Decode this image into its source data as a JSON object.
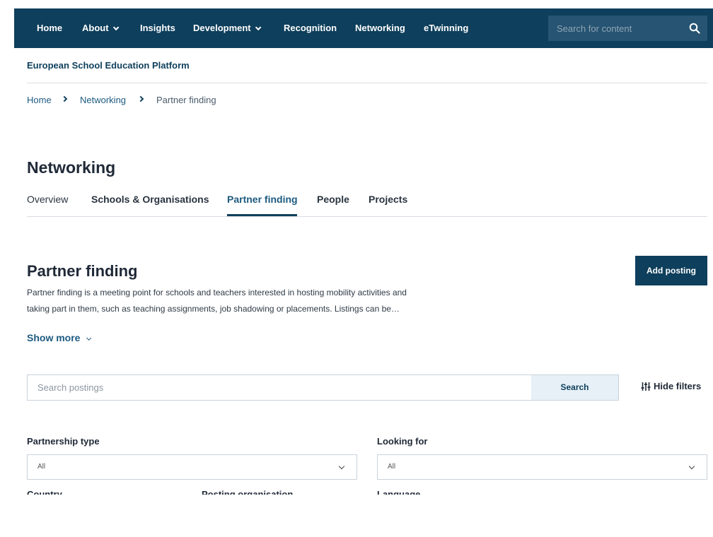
{
  "nav": {
    "items": [
      {
        "label": "Home",
        "dropdown": false
      },
      {
        "label": "About",
        "dropdown": true
      },
      {
        "label": "Insights",
        "dropdown": false
      },
      {
        "label": "Development",
        "dropdown": true
      },
      {
        "label": "Recognition",
        "dropdown": false
      },
      {
        "label": "Networking",
        "dropdown": false
      },
      {
        "label": "eTwinning",
        "dropdown": false
      }
    ],
    "search_placeholder": "Search for content",
    "search_icon": "search-icon"
  },
  "site_title": "European School Education Platform",
  "breadcrumb": {
    "items": [
      "Home",
      "Networking",
      "Partner finding"
    ]
  },
  "section": {
    "title": "Networking",
    "tabs": [
      {
        "label": "Overview",
        "active": false
      },
      {
        "label": "Schools & Organisations",
        "active": false
      },
      {
        "label": "Partner finding",
        "active": true
      },
      {
        "label": "People",
        "active": false
      },
      {
        "label": "Projects",
        "active": false
      }
    ]
  },
  "page": {
    "title": "Partner finding",
    "add_button": "Add posting",
    "description_lines": [
      "Partner finding is a meeting point for schools and teachers interested in hosting mobility activities and",
      "taking part in them, such as teaching assignments, job shadowing or placements. Listings can be…"
    ],
    "show_more": "Show more"
  },
  "search": {
    "placeholder": "Search postings",
    "button": "Search",
    "hide_filters": "Hide filters"
  },
  "filters": {
    "partnership_type": {
      "label": "Partnership type",
      "value": "All"
    },
    "looking_for": {
      "label": "Looking for",
      "value": "All"
    },
    "country": {
      "label": "Country"
    },
    "posting_organisation": {
      "label": "Posting organisation"
    },
    "language": {
      "label": "Language"
    }
  },
  "colors": {
    "nav_bg": "#0e3f5c",
    "accent": "#1d5a80",
    "search_btn_bg": "#e6f0f6"
  }
}
